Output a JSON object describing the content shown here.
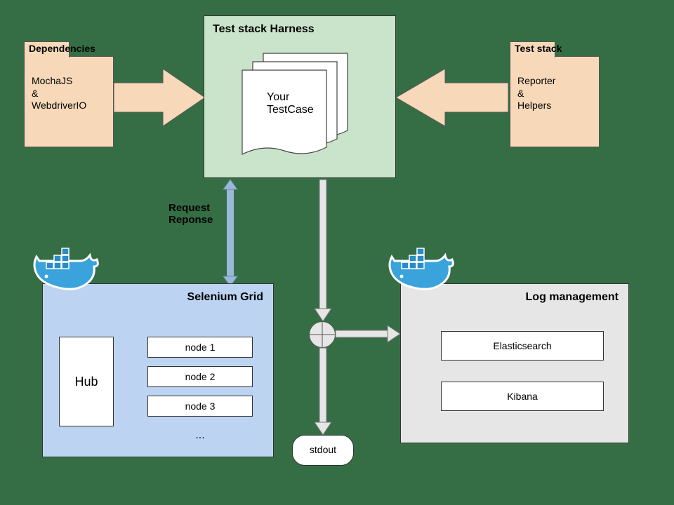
{
  "dependencies": {
    "title": "Dependencies",
    "line1": "MochaJS",
    "amp": "&",
    "line2": "WebdriverIO"
  },
  "harness": {
    "title": "Test stack Harness",
    "card_line1": "Your",
    "card_line2": "TestCase"
  },
  "teststack": {
    "title": "Test stack",
    "line1": "Reporter",
    "amp": "&",
    "line2": "Helpers"
  },
  "rr": {
    "line1": "Request",
    "line2": "Reponse"
  },
  "selenium": {
    "title": "Selenium Grid",
    "hub": "Hub",
    "nodes": [
      "node 1",
      "node 2",
      "node 3"
    ],
    "more": "..."
  },
  "log": {
    "title": "Log management",
    "es": "Elasticsearch",
    "kibana": "Kibana"
  },
  "stdout": "stdout",
  "colors": {
    "peach": "#f7d9b9",
    "green": "#c9e4ca",
    "blue": "#bcd4f2",
    "grey": "#e6e6e6",
    "bg": "#356e45"
  },
  "icons": {
    "docker_left": "docker-icon",
    "docker_right": "docker-icon"
  }
}
